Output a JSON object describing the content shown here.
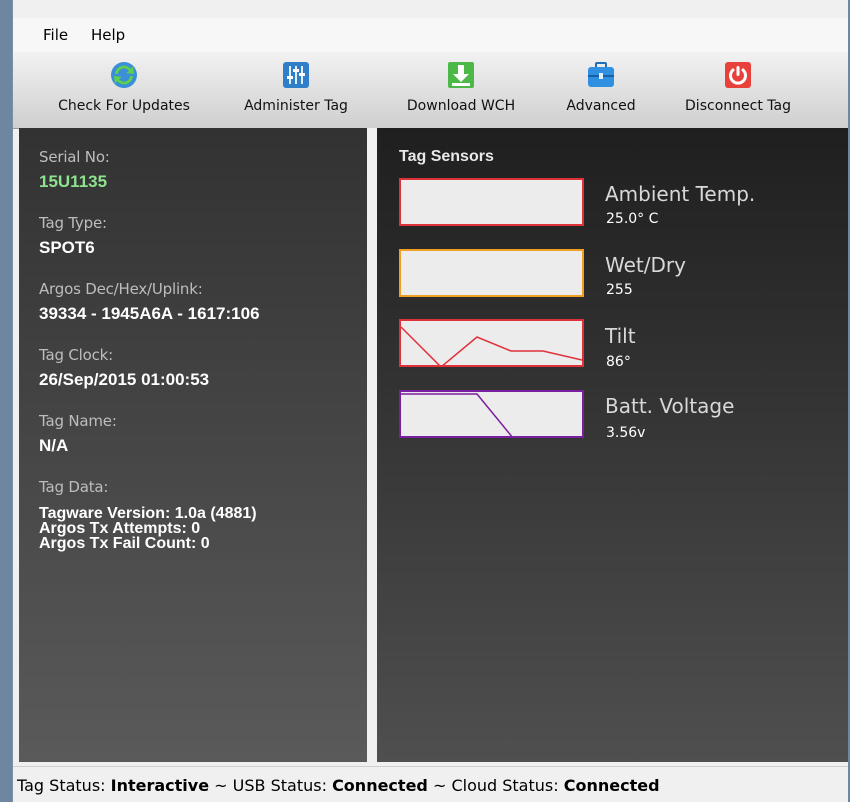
{
  "menu": {
    "file": "File",
    "help": "Help"
  },
  "toolbar": {
    "check_updates": "Check For Updates",
    "administer_tag": "Administer Tag",
    "download_wch": "Download WCH",
    "advanced": "Advanced",
    "disconnect_tag": "Disconnect Tag"
  },
  "tag_info": {
    "serial_label": "Serial No:",
    "serial_value": "15U1135",
    "type_label": "Tag Type:",
    "type_value": "SPOT6",
    "argos_label": "Argos Dec/Hex/Uplink:",
    "argos_value": "39334 - 1945A6A - 1617:106",
    "clock_label": "Tag Clock:",
    "clock_value": "26/Sep/2015 01:00:53",
    "name_label": "Tag Name:",
    "name_value": "N/A",
    "data_label": "Tag Data:",
    "data_lines": [
      "Tagware Version: 1.0a (4881)",
      "Argos Tx Attempts: 0",
      "Argos Tx Fail Count: 0"
    ]
  },
  "sensors": {
    "title": "Tag Sensors",
    "items": [
      {
        "name": "Ambient Temp.",
        "value": "25.0° C",
        "color": "#e0303a"
      },
      {
        "name": "Wet/Dry",
        "value": "255",
        "color": "#f0a020"
      },
      {
        "name": "Tilt",
        "value": "86°",
        "color": "#e0303a"
      },
      {
        "name": "Batt. Voltage",
        "value": "3.56v",
        "color": "#7a1fa0"
      }
    ]
  },
  "status": {
    "tag_label": "Tag Status:",
    "tag_value": "Interactive",
    "usb_label": "~ USB Status:",
    "usb_value": "Connected",
    "cloud_label": "~ Cloud Status:",
    "cloud_value": "Connected"
  },
  "icons": {
    "check_updates": "refresh-globe-icon",
    "administer_tag": "sliders-icon",
    "download_wch": "download-icon",
    "advanced": "toolbox-icon",
    "disconnect_tag": "power-icon"
  }
}
